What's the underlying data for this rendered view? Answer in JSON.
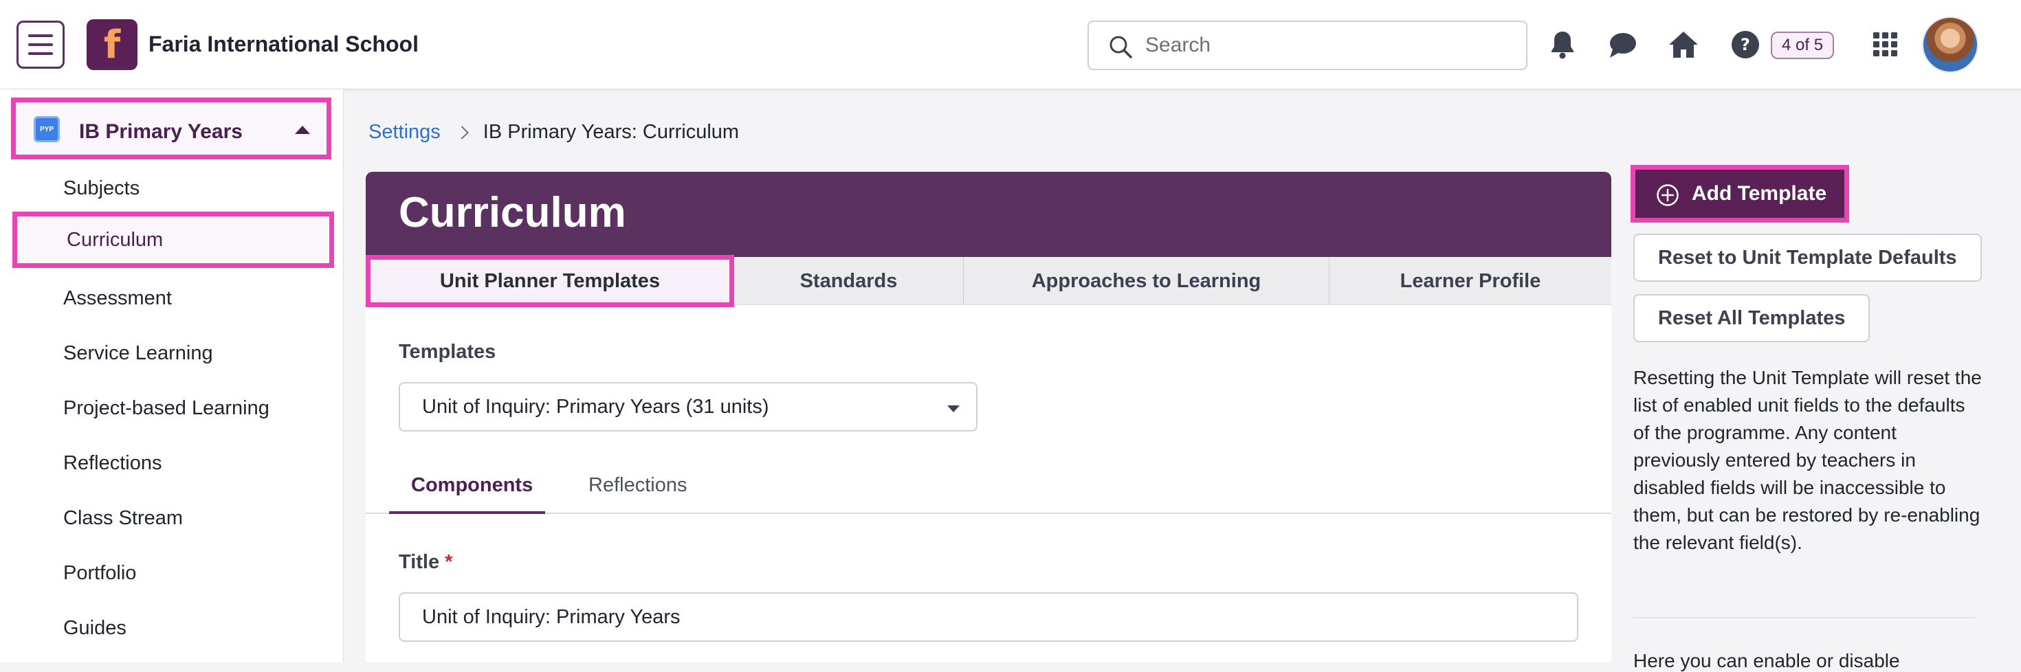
{
  "header": {
    "school_name": "Faria International School",
    "logo_letter": "f",
    "search_placeholder": "Search",
    "page_badge": "4 of 5",
    "icons": [
      "bell-icon",
      "chat-icon",
      "home-icon",
      "help-icon",
      "apps-grid-icon"
    ]
  },
  "sidebar": {
    "programme": "IB Primary Years",
    "programme_badge": "PYP",
    "items": [
      {
        "label": "Subjects"
      },
      {
        "label": "Curriculum"
      },
      {
        "label": "Assessment"
      },
      {
        "label": "Service Learning"
      },
      {
        "label": "Project-based Learning"
      },
      {
        "label": "Reflections"
      },
      {
        "label": "Class Stream"
      },
      {
        "label": "Portfolio"
      },
      {
        "label": "Guides"
      }
    ]
  },
  "breadcrumb": {
    "link": "Settings",
    "current": "IB Primary Years: Curriculum"
  },
  "main": {
    "title": "Curriculum",
    "tabs": [
      {
        "label": "Unit Planner Templates"
      },
      {
        "label": "Standards"
      },
      {
        "label": "Approaches to Learning"
      },
      {
        "label": "Learner Profile"
      }
    ],
    "templates_label": "Templates",
    "templates_value": "Unit of Inquiry: Primary Years (31 units)",
    "subtabs": [
      {
        "label": "Components"
      },
      {
        "label": "Reflections"
      }
    ],
    "title_field_label": "Title",
    "title_required": "*",
    "title_value": "Unit of Inquiry: Primary Years"
  },
  "right_panel": {
    "add_template": "Add Template",
    "reset_defaults": "Reset to Unit Template Defaults",
    "reset_all": "Reset All Templates",
    "help_text": "Resetting the Unit Template will reset the list of enabled unit fields to the defaults of the programme. Any content previously entered by teachers in disabled fields will be inaccessible to them, but can be restored by re-enabling the relevant field(s).",
    "cut_off_text": "Here you can enable or disable"
  },
  "colors": {
    "brand_purple": "#5b3160",
    "highlight_pink": "#e546b3",
    "link_blue": "#2f6fcf"
  }
}
